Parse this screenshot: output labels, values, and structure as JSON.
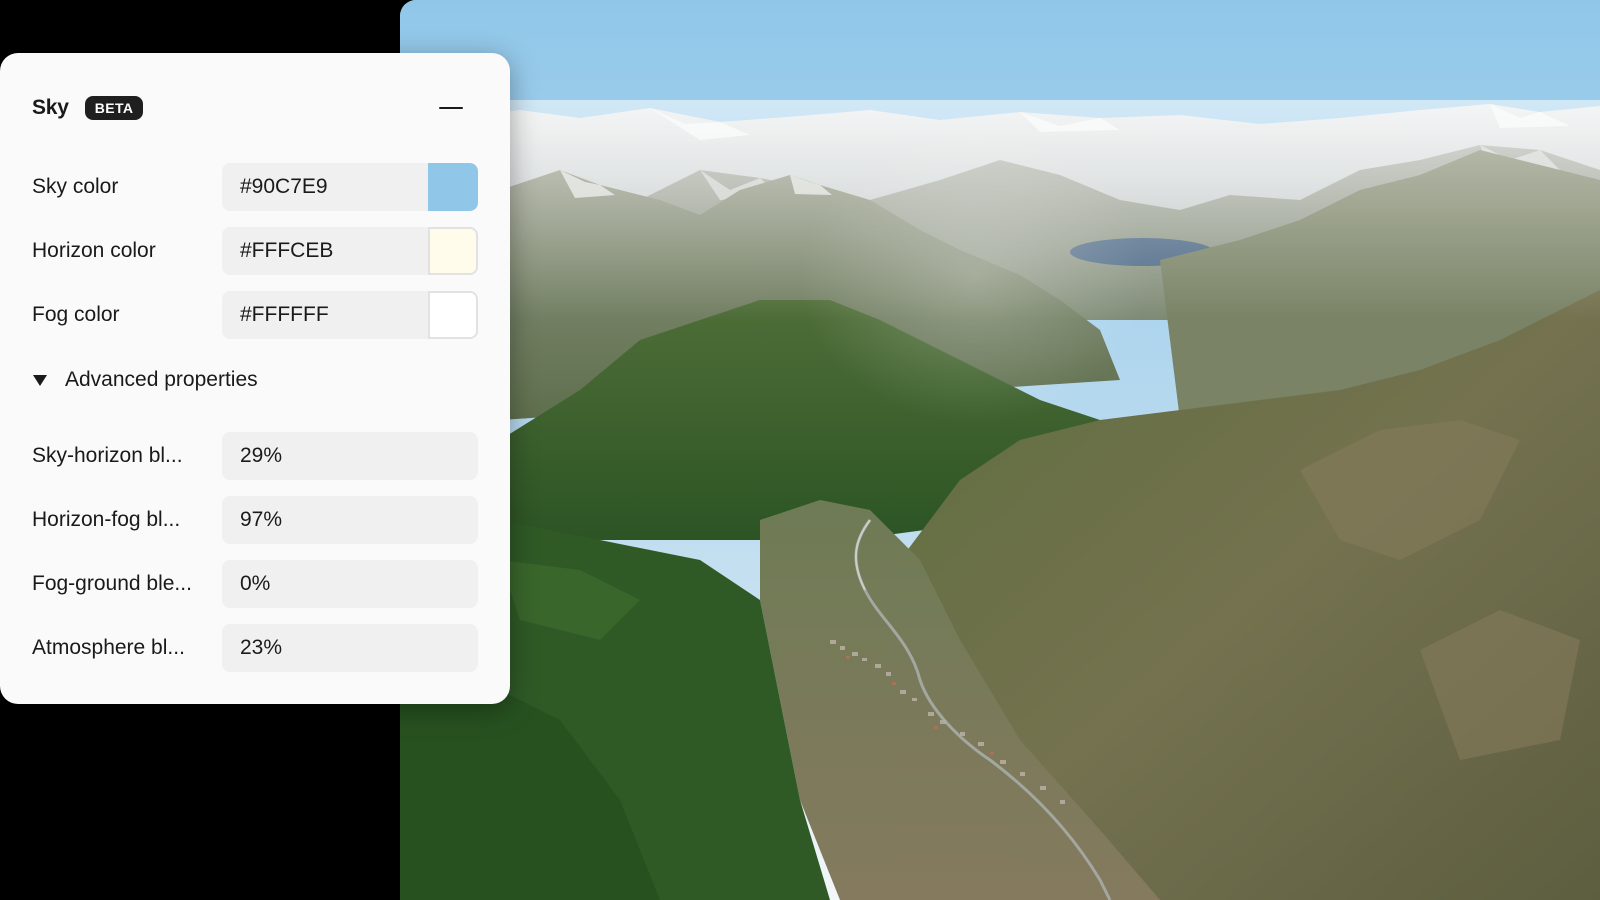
{
  "panel": {
    "title": "Sky",
    "badge": "BETA",
    "collapse_icon": "minus-icon"
  },
  "colors": [
    {
      "label": "Sky color",
      "value": "#90C7E9",
      "swatch": "#90C7E9"
    },
    {
      "label": "Horizon color",
      "value": "#FFFCEB",
      "swatch": "#FFFCEB"
    },
    {
      "label": "Fog color",
      "value": "#FFFFFF",
      "swatch": "#FFFFFF"
    }
  ],
  "advanced": {
    "label": "Advanced properties",
    "expanded": true,
    "toggle_icon": "triangle-down-icon",
    "properties": [
      {
        "label": "Sky-horizon bl...",
        "value": "29%"
      },
      {
        "label": "Horizon-fog bl...",
        "value": "97%"
      },
      {
        "label": "Fog-ground ble...",
        "value": "0%"
      },
      {
        "label": "Atmosphere bl...",
        "value": "23%"
      }
    ]
  },
  "viewport": {
    "scene": "3d-terrain-mountain-valley"
  }
}
